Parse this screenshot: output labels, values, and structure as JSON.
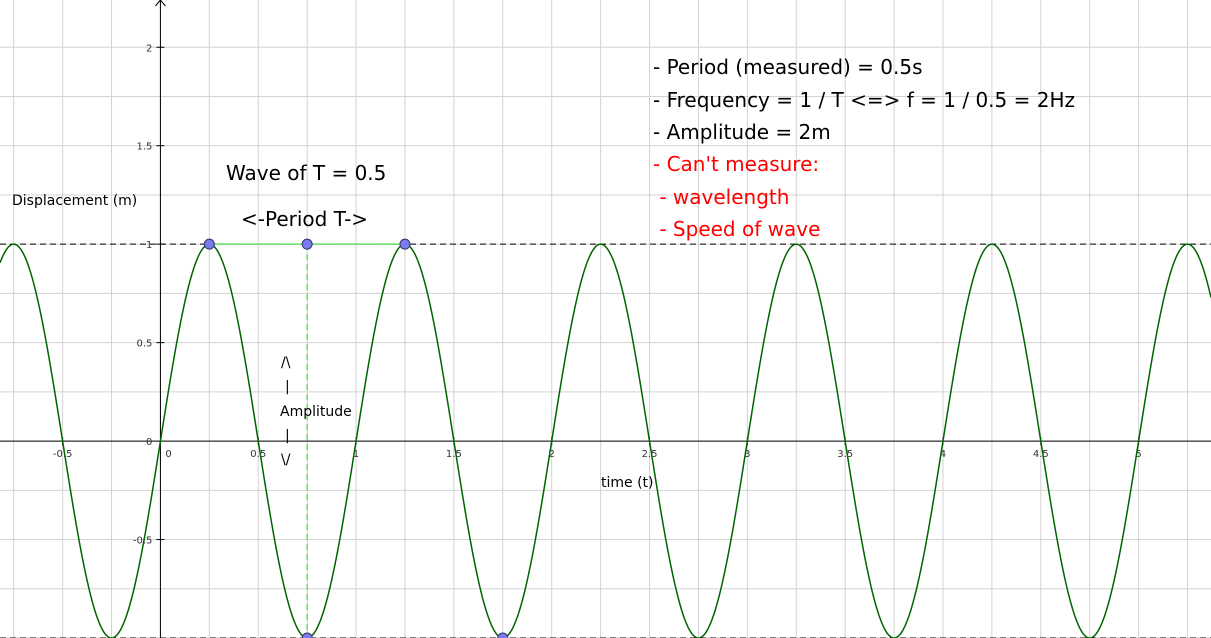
{
  "chart_data": {
    "type": "line",
    "title": "Wave of T = 0.5",
    "xlabel": "time (t)",
    "ylabel": "Displacement (m)",
    "xlim": [
      -0.82,
      5.37
    ],
    "ylim": [
      -1.0,
      2.24
    ],
    "x_ticks": [
      -0.5,
      0,
      0.5,
      1,
      1.5,
      2,
      2.5,
      3,
      3.5,
      4,
      4.5,
      5
    ],
    "x_tick_labels": [
      "-0.5",
      "0",
      "0.5",
      "1",
      "1.5",
      "2",
      "2.5",
      "3",
      "3.5",
      "4",
      "4.5",
      "5"
    ],
    "y_ticks": [
      -0.5,
      0,
      0.5,
      1,
      1.5,
      2
    ],
    "y_tick_labels": [
      "-0.5",
      "0",
      "0.5",
      "1",
      "1.5",
      "2"
    ],
    "grid": true,
    "series": [
      {
        "function": "y = sin(2*pi*x)",
        "period": 1,
        "amplitude": 1,
        "color": "#006400"
      }
    ],
    "points": [
      {
        "x": 0.25,
        "y": 1
      },
      {
        "x": 0.75,
        "y": 1
      },
      {
        "x": 1.25,
        "y": 1
      },
      {
        "x": 0.75,
        "y": -1
      },
      {
        "x": 1.75,
        "y": -1
      }
    ],
    "reference_lines": [
      {
        "orientation": "horizontal",
        "y": 1,
        "style": "dashed",
        "color": "#000000"
      },
      {
        "orientation": "horizontal",
        "y": -1,
        "style": "dashed",
        "color": "#000000"
      }
    ],
    "segments": [
      {
        "from": [
          0.25,
          1
        ],
        "to": [
          1.25,
          1
        ],
        "color": "#66dd66",
        "style": "solid"
      },
      {
        "from": [
          0.75,
          1
        ],
        "to": [
          0.75,
          -1
        ],
        "color": "#66dd66",
        "style": "dashed"
      }
    ],
    "point_color": "#7b7bf0",
    "annotations": {
      "period_marker": "<-Period T->",
      "amplitude_marker": [
        "/\\",
        "|",
        "Amplitude",
        "|",
        "\\/"
      ]
    }
  },
  "notes": {
    "black": [
      "- Period (measured) = 0.5s",
      "- Frequency = 1 / T <=> f = 1 / 0.5 = 2Hz",
      "- Amplitude = 2m"
    ],
    "red": [
      "- Can't measure:",
      " - wavelength",
      " - Speed of wave"
    ]
  },
  "colors": {
    "grid": "#d3d3d3",
    "axes": "#000000",
    "curve": "#006400",
    "helper": "#66dd66",
    "point": "#7b7bf0",
    "red_text": "#ff0000"
  }
}
